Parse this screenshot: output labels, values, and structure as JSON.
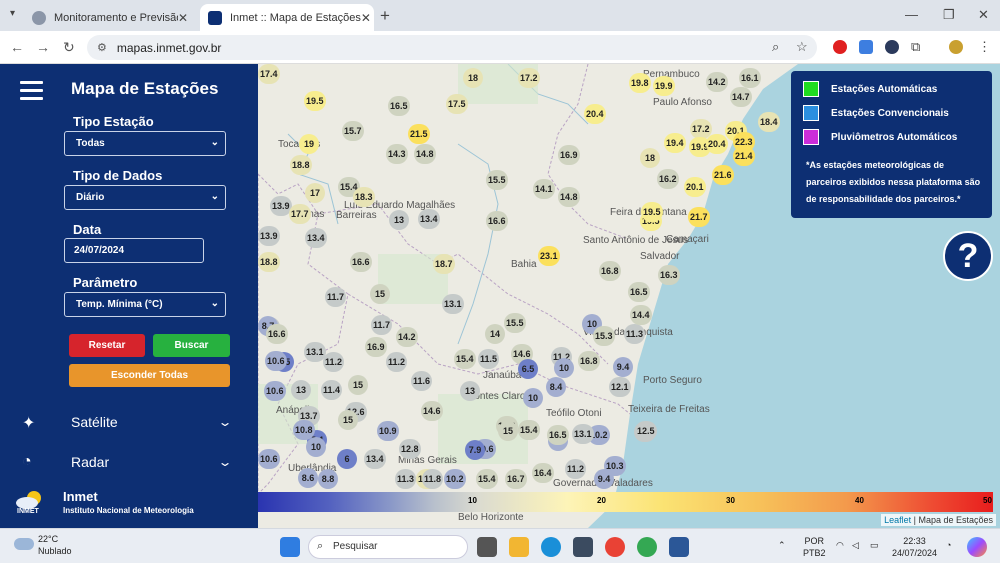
{
  "browser": {
    "tabs": [
      {
        "title": "Monitoramento e Previsão - Bra"
      },
      {
        "title": "Inmet :: Mapa de Estações"
      }
    ],
    "url": "mapas.inmet.gov.br"
  },
  "sidebar": {
    "title": "Mapa de Estações",
    "tipo_estacao_label": "Tipo Estação",
    "tipo_estacao_value": "Todas",
    "tipo_dados_label": "Tipo de Dados",
    "tipo_dados_value": "Diário",
    "data_label": "Data",
    "data_value": "24/07/2024",
    "parametro_label": "Parâmetro",
    "parametro_value": "Temp. Mínima (°C)",
    "reset_label": "Resetar",
    "search_label": "Buscar",
    "hide_all_label": "Esconder Todas",
    "menu_satelite": "Satélite",
    "menu_radar": "Radar",
    "brand_name": "Inmet",
    "brand_sub": "Instituto Nacional de Meteorologia",
    "brand_tag": "INMET"
  },
  "legend": {
    "auto": "Estações Automáticas",
    "conv": "Estações Convencionais",
    "pluv": "Pluviômetros Automáticos",
    "note": "*As estações meteorológicas de parceiros exibidos nessa plataforma são de responsabilidade dos parceiros.*",
    "colors": {
      "auto": "#1fdc1f",
      "conv": "#2b8fe0",
      "pluv": "#cc2dd9"
    }
  },
  "help": {
    "label": "?"
  },
  "scale": {
    "ticks": [
      "10",
      "20",
      "30",
      "40",
      "50"
    ]
  },
  "attribution": {
    "leaflet": "Leaflet",
    "sep": " | ",
    "source": "Mapa de Estações"
  },
  "map_labels": [
    "Tocantins",
    "Palmas",
    "Luís Eduardo Magalhães",
    "Barreiras",
    "Bahia",
    "Feira de Santana",
    "Santo Antônio de Jesus",
    "Salvador",
    "Camaçari",
    "Vitória da Conquista",
    "Montes Claros",
    "Janaúba",
    "Teófilo Otoni",
    "Porto Seguro",
    "Teixeira de Freitas",
    "Minas Gerais",
    "Governador Valadares",
    "Uberlândia",
    "Anápolis",
    "Paulo Afonso",
    "Pernambuco",
    "Belo Horizonte"
  ],
  "stations": [
    "17.4",
    "18",
    "17.2",
    "19.8",
    "19.9",
    "14.2",
    "16.1",
    "19.5",
    "16.5",
    "17.5",
    "20.4",
    "14.7",
    "18.4",
    "15.7",
    "21.5",
    "17.2",
    "20.1",
    "19",
    "14.3",
    "14.8",
    "16.9",
    "19.4",
    "19.9",
    "20.4",
    "22.3",
    "18.8",
    "18",
    "21.4",
    "15.4",
    "18.3",
    "15.5",
    "14.1",
    "14.8",
    "16.2",
    "20.1",
    "21.6",
    "13.9",
    "17.7",
    "17",
    "13",
    "13.4",
    "16.6",
    "19.5",
    "21.7",
    "19.5",
    "13.9",
    "13.4",
    "18.8",
    "16.6",
    "18.7",
    "23.1",
    "16.8",
    "16.3",
    "13",
    "11.7",
    "15",
    "13.1",
    "16.5",
    "8.7",
    "16.6",
    "11.7",
    "14.2",
    "15.5",
    "10",
    "15.3",
    "14",
    "15.4",
    "11.3",
    "14.4",
    "6.5",
    "11.2",
    "16.9",
    "11.2",
    "10.6",
    "13.1",
    "11.5",
    "14.6",
    "11.2",
    "16.8",
    "9.4",
    "6.5",
    "10",
    "10.6",
    "13",
    "11.4",
    "15",
    "11.6",
    "13",
    "10",
    "8.4",
    "12.1",
    "13.7",
    "12.6",
    "14.6",
    "10.6",
    "14.3",
    "13.4",
    "10",
    "10.2",
    "12.2",
    "7.4",
    "10.8",
    "15",
    "15",
    "15.4",
    "16.5",
    "13.1",
    "12.5",
    "10",
    "10.9",
    "12.8",
    "7.9",
    "10.6",
    "6",
    "13.4",
    "15.4",
    "16.7",
    "16.4",
    "11.2",
    "10.3",
    "8.6",
    "11.3",
    "18.7",
    "10.2",
    "9.4",
    "8.8",
    "11.8"
  ],
  "taskbar": {
    "temp": "22°C",
    "weather": "Nublado",
    "search_placeholder": "Pesquisar",
    "lang1": "POR",
    "lang2": "PTB2",
    "time": "22:33",
    "date": "24/07/2024"
  }
}
